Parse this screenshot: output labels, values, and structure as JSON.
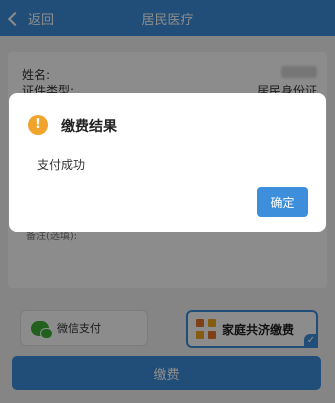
{
  "nav": {
    "back_label": "返回",
    "title": "居民医疗"
  },
  "form": {
    "name_label": "姓名:",
    "id_type_label": "证件类型:",
    "id_type_value": "居民身份证",
    "remark_label": "备注(选填):"
  },
  "payment": {
    "wechat_label": "微信支付",
    "family_label": "家庭共济缴费",
    "pay_button": "缴费"
  },
  "dialog": {
    "title": "缴费结果",
    "message": "支付成功",
    "confirm_label": "确定",
    "warn_glyph": "!"
  },
  "colors": {
    "primary": "#3d8fdc",
    "warning": "#f0a42c",
    "wechat": "#3cb035"
  }
}
